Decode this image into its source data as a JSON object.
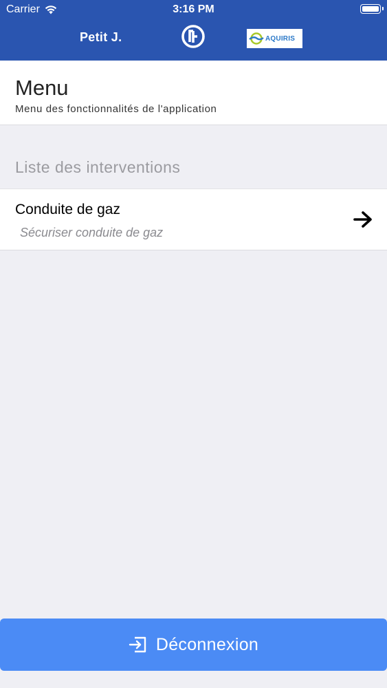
{
  "status_bar": {
    "carrier": "Carrier",
    "time": "3:16 PM",
    "wifi_icon": "wifi-icon",
    "battery_icon": "battery-icon"
  },
  "app_bar": {
    "user_name": "Petit J.",
    "app_logo_icon": "app-logo-icon",
    "partner_logo_text": "AQUIRIS",
    "background_color": "#2a55b0"
  },
  "header": {
    "title": "Menu",
    "subtitle": "Menu des fonctionnalités de l'application"
  },
  "interventions": {
    "section_title": "Liste des interventions",
    "items": [
      {
        "title": "Conduite de gaz",
        "subtitle": "Sécuriser conduite de gaz",
        "icon": "arrow-right-icon"
      }
    ]
  },
  "logout": {
    "label": "Déconnexion",
    "icon": "logout-icon",
    "color": "#4b8bf5"
  }
}
